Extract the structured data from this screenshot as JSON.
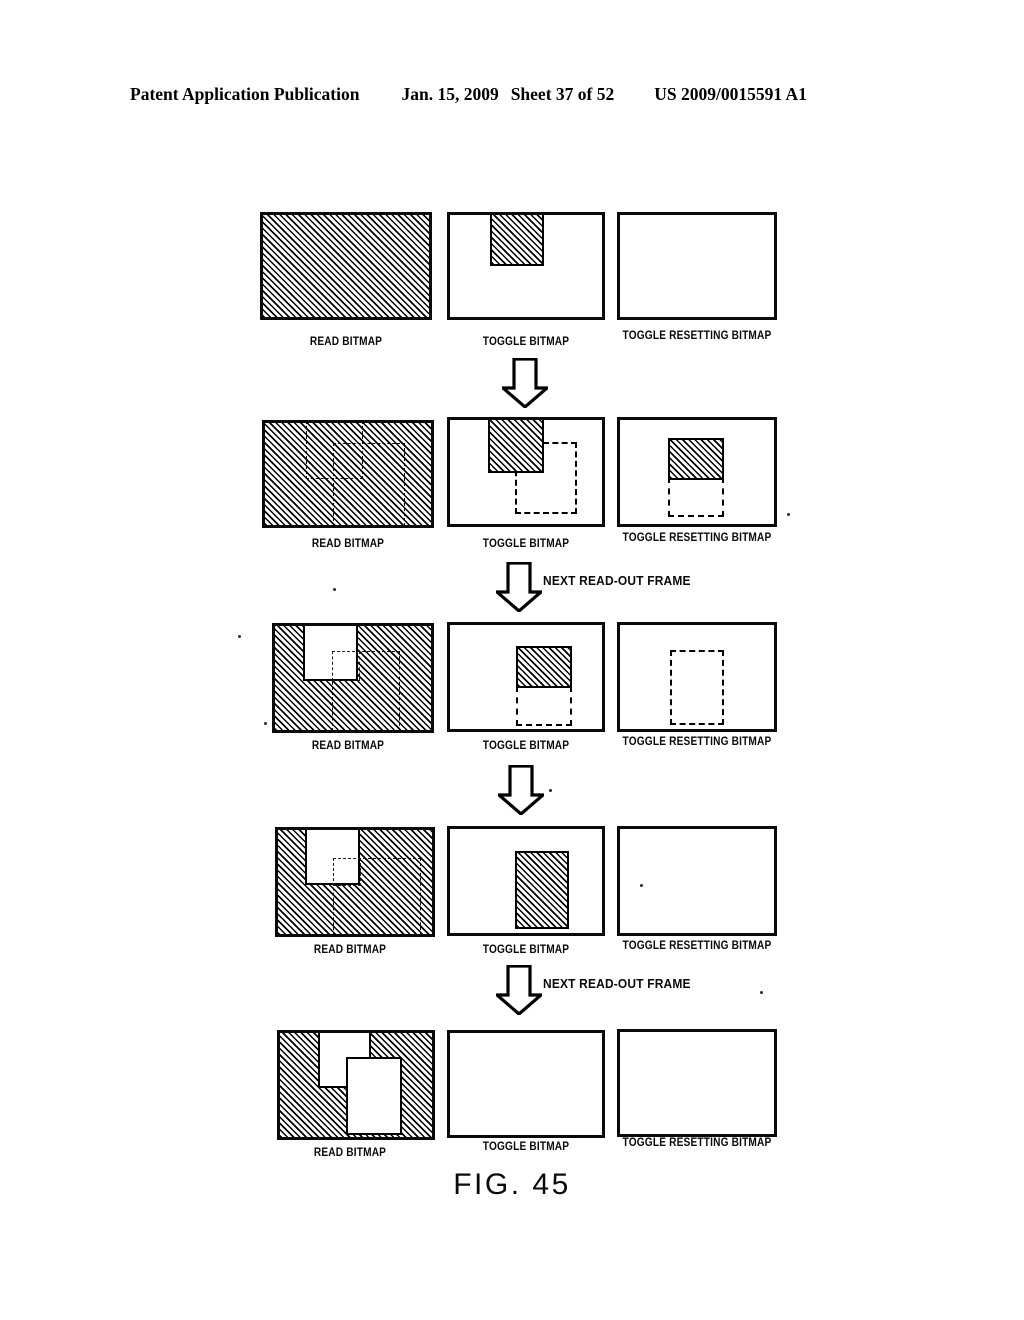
{
  "header": {
    "publication": "Patent Application Publication",
    "date": "Jan. 15, 2009",
    "sheet": "Sheet 37 of 52",
    "number": "US 2009/0015591 A1"
  },
  "figure": {
    "caption": "FIG. 45",
    "column_labels": {
      "read": "READ BITMAP",
      "toggle": "TOGGLE BITMAP",
      "toggle_resetting": "TOGGLE RESETTING BITMAP"
    },
    "rows": [
      {
        "id": "row-1",
        "panels": [
          {
            "name": "read-bitmap",
            "label": "READ BITMAP",
            "fill": "hatched-full",
            "shapes": []
          },
          {
            "name": "toggle-bitmap",
            "label": "TOGGLE BITMAP",
            "fill": "empty",
            "shapes": [
              {
                "type": "hatched",
                "note": "hatched block at top center"
              }
            ]
          },
          {
            "name": "toggle-resetting-bitmap",
            "label": "TOGGLE RESETTING BITMAP",
            "fill": "empty",
            "shapes": []
          }
        ]
      },
      {
        "id": "row-2",
        "panels": [
          {
            "name": "read-bitmap",
            "label": "READ BITMAP",
            "fill": "hatched-full",
            "shapes": [
              {
                "type": "dashed",
                "note": "two dashed outlines over hatch"
              }
            ]
          },
          {
            "name": "toggle-bitmap",
            "label": "TOGGLE BITMAP",
            "fill": "empty",
            "shapes": [
              {
                "type": "hatched",
                "note": "hatched block at top center"
              },
              {
                "type": "dashed",
                "note": "dashed rect offset right and down"
              }
            ]
          },
          {
            "name": "toggle-resetting-bitmap",
            "label": "TOGGLE RESETTING BITMAP",
            "fill": "empty",
            "shapes": [
              {
                "type": "hatched",
                "note": "hatched block center"
              },
              {
                "type": "dashed",
                "note": "dashed rect below hatched block"
              }
            ]
          }
        ]
      },
      {
        "id": "row-3",
        "panels": [
          {
            "name": "read-bitmap",
            "label": "READ BITMAP",
            "fill": "hatched-full",
            "shapes": [
              {
                "type": "white",
                "note": "white square punched at top"
              },
              {
                "type": "dashed",
                "note": "dashed outlines over hatch"
              }
            ]
          },
          {
            "name": "toggle-bitmap",
            "label": "TOGGLE BITMAP",
            "fill": "empty",
            "shapes": [
              {
                "type": "hatched",
                "note": "hatched block upper right of center"
              },
              {
                "type": "dashed",
                "note": "dashed rect directly below"
              }
            ]
          },
          {
            "name": "toggle-resetting-bitmap",
            "label": "TOGGLE RESETTING BITMAP",
            "fill": "empty",
            "shapes": [
              {
                "type": "dashed",
                "note": "tall dashed rect center"
              }
            ]
          }
        ]
      },
      {
        "id": "row-4",
        "panels": [
          {
            "name": "read-bitmap",
            "label": "READ BITMAP",
            "fill": "hatched-full",
            "shapes": [
              {
                "type": "white",
                "note": "white square punched at top"
              },
              {
                "type": "dashed",
                "note": "dashed outlines over hatch"
              }
            ]
          },
          {
            "name": "toggle-bitmap",
            "label": "TOGGLE BITMAP",
            "fill": "empty",
            "shapes": [
              {
                "type": "hatched",
                "note": "tall hatched rect center"
              }
            ]
          },
          {
            "name": "toggle-resetting-bitmap",
            "label": "TOGGLE RESETTING BITMAP",
            "fill": "empty",
            "shapes": []
          }
        ]
      },
      {
        "id": "row-5",
        "panels": [
          {
            "name": "read-bitmap",
            "label": "READ BITMAP",
            "fill": "hatched-full",
            "shapes": [
              {
                "type": "white",
                "note": "white square punched upper left-center"
              },
              {
                "type": "white",
                "note": "second white rect overlapping below right"
              }
            ]
          },
          {
            "name": "toggle-bitmap",
            "label": "TOGGLE BITMAP",
            "fill": "empty",
            "shapes": []
          },
          {
            "name": "toggle-resetting-bitmap",
            "label": "TOGGLE RESETTING BITMAP",
            "fill": "empty",
            "shapes": []
          }
        ]
      }
    ],
    "arrows": [
      {
        "id": "arrow-1",
        "label": ""
      },
      {
        "id": "arrow-2",
        "label": "NEXT READ-OUT FRAME"
      },
      {
        "id": "arrow-3",
        "label": ""
      },
      {
        "id": "arrow-4",
        "label": "NEXT READ-OUT FRAME"
      }
    ]
  }
}
